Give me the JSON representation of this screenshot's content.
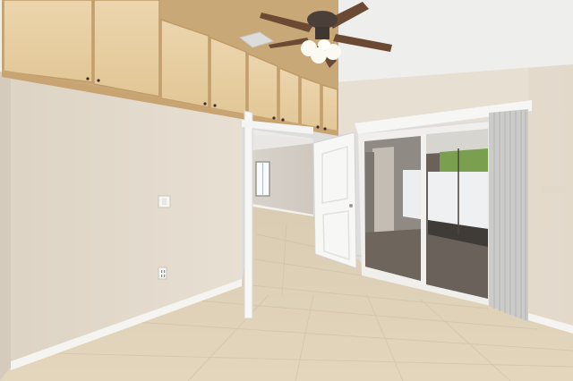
{
  "scene": {
    "description_visible_text": "",
    "colors": {
      "ceiling": "#eeeeec",
      "wall_left": "#e3dbcd",
      "wall_right": "#e6ddd0",
      "cabinet": "#e8cfa4",
      "cabinet_edge": "#c9a877",
      "floor": "#dccfb6",
      "door": "#f7f7f5",
      "trim": "#f4f4f2",
      "blind": "#c9c9c7",
      "patio": "#6e655d",
      "fan_blade": "#6b4a33"
    },
    "icons": [
      "ceiling-fan-icon",
      "light-switch-icon",
      "outlet-icon",
      "door-handle-icon"
    ]
  }
}
